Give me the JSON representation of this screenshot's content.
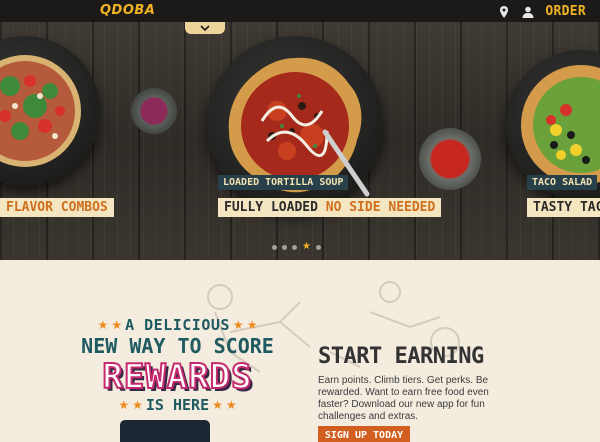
{
  "header": {
    "logo": "QDOBA",
    "order_label": "ORDER",
    "icons": [
      "location-pin-icon",
      "user-icon"
    ],
    "accent": "#f0b323"
  },
  "menu_tab": {
    "icon": "chevron-down-icon"
  },
  "carousel": {
    "slides": [
      {
        "title": "FLAVOR COMBOS"
      },
      {
        "tag": "LOADED TORTILLA SOUP",
        "title_main": "FULLY LOADED ",
        "title_highlight": "NO SIDE NEEDED"
      },
      {
        "tag": "TACO SALAD",
        "title": "TASTY TACOS"
      }
    ],
    "active_dot": 4,
    "dot_count": 5
  },
  "rewards": {
    "line1": "A DELICIOUS",
    "line2": "NEW WAY TO SCORE",
    "line3": "REWARDS",
    "line4": "IS HERE",
    "earn_title": "START EARNING",
    "earn_body": "Earn points. Climb tiers. Get perks. Be rewarded. Want to earn free food even faster? Download our new app for fun challenges and extras.",
    "signup_label": "SIGN UP TODAY",
    "colors": {
      "teal": "#1f5a60",
      "pink": "#c52a6f",
      "orange": "#d25f1f"
    }
  }
}
